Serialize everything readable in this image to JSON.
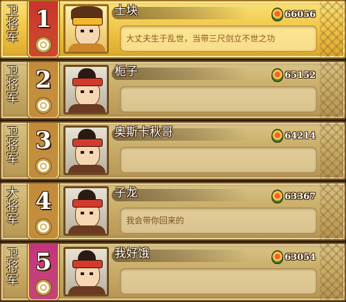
{
  "leaderboard": {
    "entries": [
      {
        "rank": "1",
        "title": "卫将军",
        "name": "士块",
        "power": "66056",
        "motto": "大丈夫生于乱世，当带三尺剑立不世之功",
        "banner_color": "#c8312a",
        "avatar": "hero"
      },
      {
        "rank": "2",
        "title": "卫将军",
        "name": "栀子",
        "power": "65152",
        "motto": "",
        "banner_color": "#c28a3a",
        "avatar": "soldier"
      },
      {
        "rank": "3",
        "title": "卫将军",
        "name": "奥斯卡秋哥",
        "power": "64214",
        "motto": "",
        "banner_color": "#c28a3a",
        "avatar": "soldier"
      },
      {
        "rank": "4",
        "title": "大将军",
        "name": "子龙",
        "power": "63367",
        "motto": "我会带你回来的",
        "banner_color": "#c28a3a",
        "avatar": "soldier"
      },
      {
        "rank": "5",
        "title": "卫将军",
        "name": "我好饿",
        "power": "63054",
        "motto": "",
        "banner_color": "#c4327c",
        "avatar": "soldier"
      }
    ]
  }
}
